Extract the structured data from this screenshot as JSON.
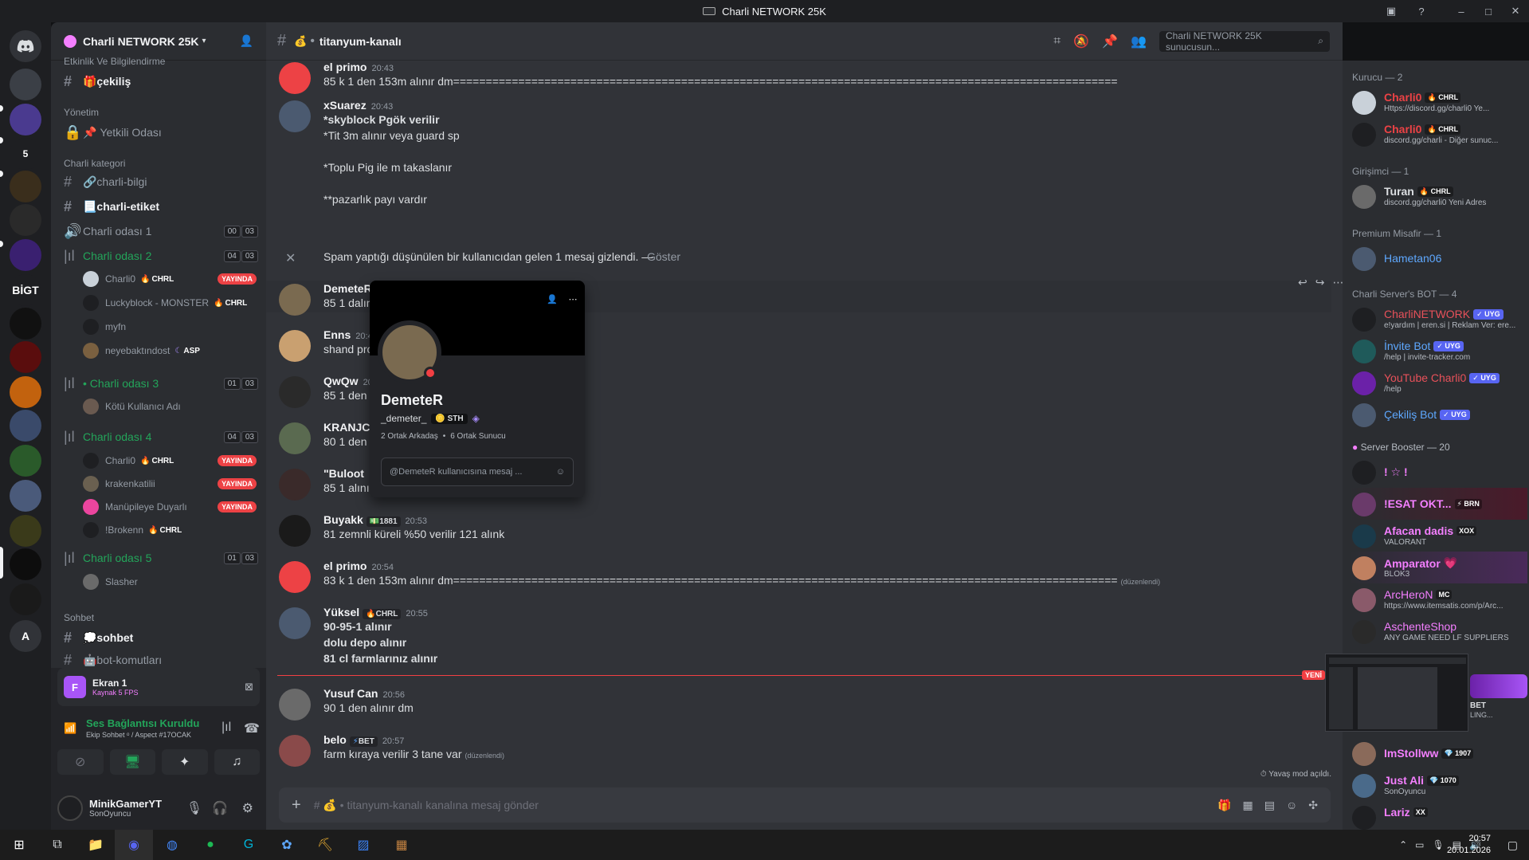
{
  "window": {
    "title": "Charli NETWORK 25K",
    "min": "–",
    "max": "□",
    "close": "✕"
  },
  "server": {
    "name": "Charli NETWORK 25K"
  },
  "guild_labels": [
    "5",
    "BİGT",
    "A"
  ],
  "categories": {
    "events": "Etkinlik Ve Bilgilendirme",
    "admin": "Yönetim",
    "charli": "Charli kategori",
    "chat": "Sohbet"
  },
  "channels": {
    "cekilis": "🎁çekiliş",
    "yetkili": "Yetkili Odası",
    "bilgi": "🔗charli-bilgi",
    "etiket": "📃charli-etiket",
    "oda1": "Charli odası 1",
    "oda2": "Charli odası 2",
    "oda3": "• Charli odası 3",
    "oda4": "Charli odası 4",
    "oda5": "Charli odası 5",
    "sohbet": "💭sohbet",
    "botkomut": "🤖bot-komutları"
  },
  "voice_counts": {
    "oda1": [
      "00",
      "03"
    ],
    "oda2": [
      "04",
      "03"
    ],
    "oda3": [
      "01",
      "03"
    ],
    "oda4": [
      "04",
      "03"
    ],
    "oda5": [
      "01",
      "03"
    ]
  },
  "voice_users": {
    "oda2": [
      {
        "name": "Charli0",
        "tag": "CHRL",
        "live": "YAYINDA"
      },
      {
        "name": "Luckyblock - MONSTER",
        "tag": "CHRL",
        "live": ""
      },
      {
        "name": "myfn",
        "tag": "",
        "live": ""
      },
      {
        "name": "neyebaktındost",
        "tag": "ASP",
        "live": ""
      }
    ],
    "oda3": [
      {
        "name": "Kötü Kullanıcı Adı",
        "tag": "",
        "live": ""
      }
    ],
    "oda4": [
      {
        "name": "Charli0",
        "tag": "CHRL",
        "live": ""
      },
      {
        "name": "krakenkatilii",
        "tag": "",
        "live": "YAYINDA"
      },
      {
        "name": "Manüpileye Duyarlı",
        "tag": "",
        "live": "YAYINDA"
      },
      {
        "name": "!Brokenn",
        "tag": "CHRL",
        "live": ""
      }
    ],
    "oda5": [
      {
        "name": "Slasher",
        "tag": "",
        "live": ""
      }
    ]
  },
  "live_label": "YAYINDA",
  "stream_panel": {
    "title": "Ekran 1",
    "sub": "Kaynak 5 FPS",
    "avatar_letter": "F"
  },
  "voice_status": {
    "title": "Ses Bağlantısı Kuruldu",
    "sub": "Ekip Sohbet ᵒ / Aspect #17OCAK"
  },
  "user": {
    "name": "MinikGamerYT",
    "status": "SonOyuncu"
  },
  "channel_header": {
    "name": "titanyum-kanalı",
    "prefix": "•",
    "search_placeholder": "Charli NETWORK 25K sunucusun..."
  },
  "messages": [
    {
      "user": "el primo",
      "time": "20:43",
      "lines": [
        "85 k 1 den 153m alınır dm======================================================================================================"
      ]
    },
    {
      "user": "xSuarez",
      "time": "20:43",
      "lines": [
        "*skyblock Pgök verilir",
        "*Tit 3m alınır veya guard sp",
        "",
        "*Toplu Pig ile m takaslanır",
        "",
        "**pazarlık payı vardır"
      ]
    },
    {
      "user": "DemeteR",
      "time": "",
      "lines": [
        "85 1 dalınır"
      ]
    },
    {
      "user": "Enns",
      "time": "20:48",
      "lines": [
        "shand prof"
      ]
    },
    {
      "user": "QwQw",
      "time": "20:4",
      "lines": [
        "85 1 den 12"
      ]
    },
    {
      "user": "KRANJCA",
      "time": "",
      "lines": [
        "80 1 den ve"
      ]
    },
    {
      "user": "\"Buloot",
      "time": "",
      "lines": [
        "85 1 alınır"
      ]
    },
    {
      "user": "Buyakk",
      "time": "20:53",
      "tag": "1881",
      "lines": [
        "81 zemnli küreli %50 verilir 121 alınk"
      ]
    },
    {
      "user": "el primo",
      "time": "20:54",
      "lines": [
        "83 k 1 den 153m alınır dm======================================================================================================"
      ],
      "edited": "(düzenlendi)"
    },
    {
      "user": "Yüksel",
      "time": "20:55",
      "tag": "CHRL",
      "lines": [
        "90-95-1 alınır",
        "dolu depo alınır",
        "81 cl farmlarınız alınır"
      ]
    },
    {
      "user": "Yusuf Can",
      "time": "20:56",
      "lines": [
        "90 1 den alınır dm"
      ]
    },
    {
      "user": "belo",
      "time": "20:57",
      "tag": "BET",
      "lines": [
        "farm kıraya verilir 3 tane var"
      ],
      "edited": "(düzenlendi)"
    }
  ],
  "spam_notice": {
    "text": "Spam yaptığı düşünülen bir kullanıcıdan gelen 1 mesaj gizlendi. — ",
    "link": "Göster"
  },
  "new_label": "YENİ",
  "slowmode": "Yavaş mod açıldı.",
  "composer_placeholder": "titanyum-kanalı kanalına mesaj gönder",
  "popout": {
    "name": "DemeteR",
    "username": "_demeter_",
    "tag": "STH",
    "mutual_friends": "2 Ortak Arkadaş",
    "mutual_servers": "6 Ortak Sunucu",
    "message_placeholder": "@DemeteR kullanıcısına mesaj ..."
  },
  "member_groups": {
    "kurucu": "Kurucu — 2",
    "girisimci": "Girişimci — 1",
    "premium": "Premium Misafir — 1",
    "bots": "Charli Server's BOT — 4",
    "boosters": "Server Booster — 20"
  },
  "members": [
    {
      "name": "Charli0",
      "badge": "CHRL",
      "status": "Https://discord.gg/charli0 Ye...",
      "color": "#ed4245"
    },
    {
      "name": "Charli0",
      "badge": "CHRL",
      "status": "discord.gg/charli - Diğer sunuc...",
      "color": "#ed4245"
    },
    {
      "name": "Turan",
      "badge": "CHRL",
      "status": "discord.gg/charli0 Yeni Adres",
      "color": "#dbdee1"
    },
    {
      "name": "Hametan06",
      "badge": "",
      "status": "",
      "color": "#5ea8ff"
    },
    {
      "name": "CharliNETWORK",
      "badge": "UYG",
      "status": "e!yardım | eren.si | Reklam Ver: ere...",
      "color": "#e8515a"
    },
    {
      "name": "İnvite Bot",
      "badge": "UYG",
      "status": "/help | invite-tracker.com",
      "color": "#5ea8ff"
    },
    {
      "name": "YouTube Charli0",
      "badge": "UYG",
      "status": "/help",
      "color": "#e8515a"
    },
    {
      "name": "Çekiliş Bot",
      "badge": "UYG",
      "status": "",
      "color": "#5ea8ff"
    },
    {
      "name": "! ☆ !",
      "badge": "",
      "status": "",
      "color": "#f47fff"
    },
    {
      "name": "!ESAT OKT...",
      "badge": "BRN",
      "status": "",
      "color": "#f47fff"
    },
    {
      "name": "Afacan dadis",
      "badge": "XOX",
      "status": "VALORANT",
      "color": "#f47fff"
    },
    {
      "name": "Amparator",
      "badge": "",
      "status": "BLOK3",
      "color": "#f47fff"
    },
    {
      "name": "ArcHeroN",
      "badge": "MC",
      "status": "https://www.itemsatis.com/p/Arc...",
      "color": "#f47fff"
    },
    {
      "name": "AschenteShop",
      "badge": "",
      "status": "ANY GAME NEED LF SUPPLIERS",
      "color": "#f47fff"
    },
    {
      "name": "ImStollww",
      "badge": "1907",
      "status": "",
      "color": "#f47fff"
    },
    {
      "name": "Just Ali",
      "badge": "1070",
      "status": "SonOyuncu",
      "color": "#f47fff"
    },
    {
      "name": "Lariz",
      "badge": "XX",
      "status": "",
      "color": "#f47fff"
    }
  ],
  "member_extra": {
    "bet": "BET",
    "ling": "LING..."
  },
  "taskbar": {
    "time": "20:57",
    "date": "20.01.2026"
  },
  "colors": {
    "accent": "#5865f2",
    "voice": "#23a55a",
    "live": "#ed4245",
    "booster": "#f47fff"
  }
}
